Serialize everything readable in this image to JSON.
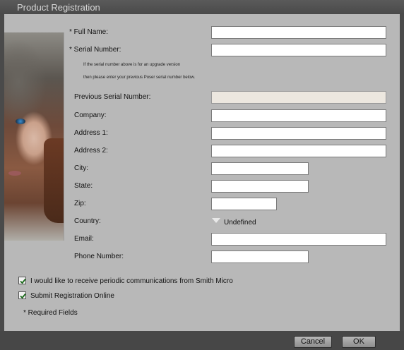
{
  "dialog": {
    "title": "Product Registration"
  },
  "form": {
    "full_name": {
      "label": "* Full Name:",
      "value": ""
    },
    "serial_number": {
      "label": "* Serial Number:",
      "value": ""
    },
    "upgrade_note_line1": "If the serial number above is for an upgrade version",
    "upgrade_note_line2": "then please enter your previous Poser serial number below.",
    "previous_serial": {
      "label": "Previous Serial Number:",
      "value": ""
    },
    "company": {
      "label": "Company:",
      "value": ""
    },
    "address1": {
      "label": "Address 1:",
      "value": ""
    },
    "address2": {
      "label": "Address 2:",
      "value": ""
    },
    "city": {
      "label": "City:",
      "value": ""
    },
    "state": {
      "label": "State:",
      "value": ""
    },
    "zip": {
      "label": "Zip:",
      "value": ""
    },
    "country": {
      "label": "Country:",
      "selected": "Undefined"
    },
    "email": {
      "label": "Email:",
      "value": ""
    },
    "phone": {
      "label": "Phone Number:",
      "value": ""
    }
  },
  "options": {
    "communications": {
      "label": "I would like to receive periodic communications from Smith Micro",
      "checked": true
    },
    "submit_online": {
      "label": "Submit Registration Online",
      "checked": true
    }
  },
  "required_note": "* Required Fields",
  "buttons": {
    "cancel": "Cancel",
    "ok": "OK"
  }
}
